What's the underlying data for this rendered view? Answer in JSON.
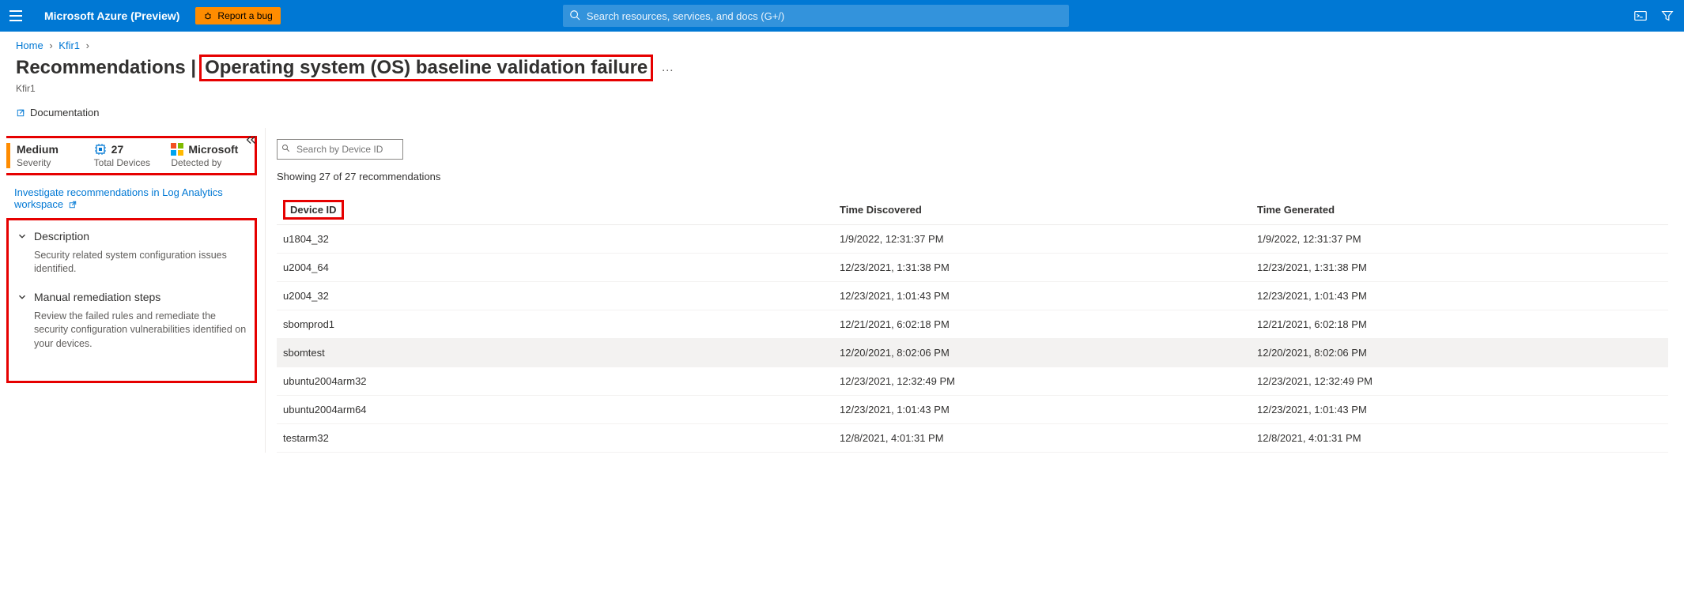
{
  "header": {
    "brand": "Microsoft Azure (Preview)",
    "bug_label": "Report a bug",
    "search_placeholder": "Search resources, services, and docs (G+/)"
  },
  "breadcrumb": {
    "home": "Home",
    "item": "Kfir1"
  },
  "page": {
    "title_prefix": "Recommendations |",
    "title_main": "Operating system (OS) baseline validation failure",
    "more": "…",
    "subtitle": "Kfir1",
    "doc_label": "Documentation"
  },
  "stats": {
    "severity_value": "Medium",
    "severity_label": "Severity",
    "devices_value": "27",
    "devices_label": "Total Devices",
    "detected_value": "Microsoft",
    "detected_label": "Detected by"
  },
  "link": "Investigate recommendations in Log Analytics workspace",
  "sections": {
    "desc_title": "Description",
    "desc_body": "Security related system configuration issues identified.",
    "rem_title": "Manual remediation steps",
    "rem_body": "Review the failed rules and remediate the security configuration vulnerabilities identified on your devices."
  },
  "right": {
    "search_placeholder": "Search by Device ID",
    "showing": "Showing 27 of 27 recommendations",
    "cols": {
      "device": "Device ID",
      "discovered": "Time Discovered",
      "generated": "Time Generated"
    },
    "rows": [
      {
        "d": "u1804_32",
        "t1": "1/9/2022, 12:31:37 PM",
        "t2": "1/9/2022, 12:31:37 PM"
      },
      {
        "d": "u2004_64",
        "t1": "12/23/2021, 1:31:38 PM",
        "t2": "12/23/2021, 1:31:38 PM"
      },
      {
        "d": "u2004_32",
        "t1": "12/23/2021, 1:01:43 PM",
        "t2": "12/23/2021, 1:01:43 PM"
      },
      {
        "d": "sbomprod1",
        "t1": "12/21/2021, 6:02:18 PM",
        "t2": "12/21/2021, 6:02:18 PM"
      },
      {
        "d": "sbomtest",
        "t1": "12/20/2021, 8:02:06 PM",
        "t2": "12/20/2021, 8:02:06 PM",
        "hover": true
      },
      {
        "d": "ubuntu2004arm32",
        "t1": "12/23/2021, 12:32:49 PM",
        "t2": "12/23/2021, 12:32:49 PM"
      },
      {
        "d": "ubuntu2004arm64",
        "t1": "12/23/2021, 1:01:43 PM",
        "t2": "12/23/2021, 1:01:43 PM"
      },
      {
        "d": "testarm32",
        "t1": "12/8/2021, 4:01:31 PM",
        "t2": "12/8/2021, 4:01:31 PM"
      }
    ]
  }
}
